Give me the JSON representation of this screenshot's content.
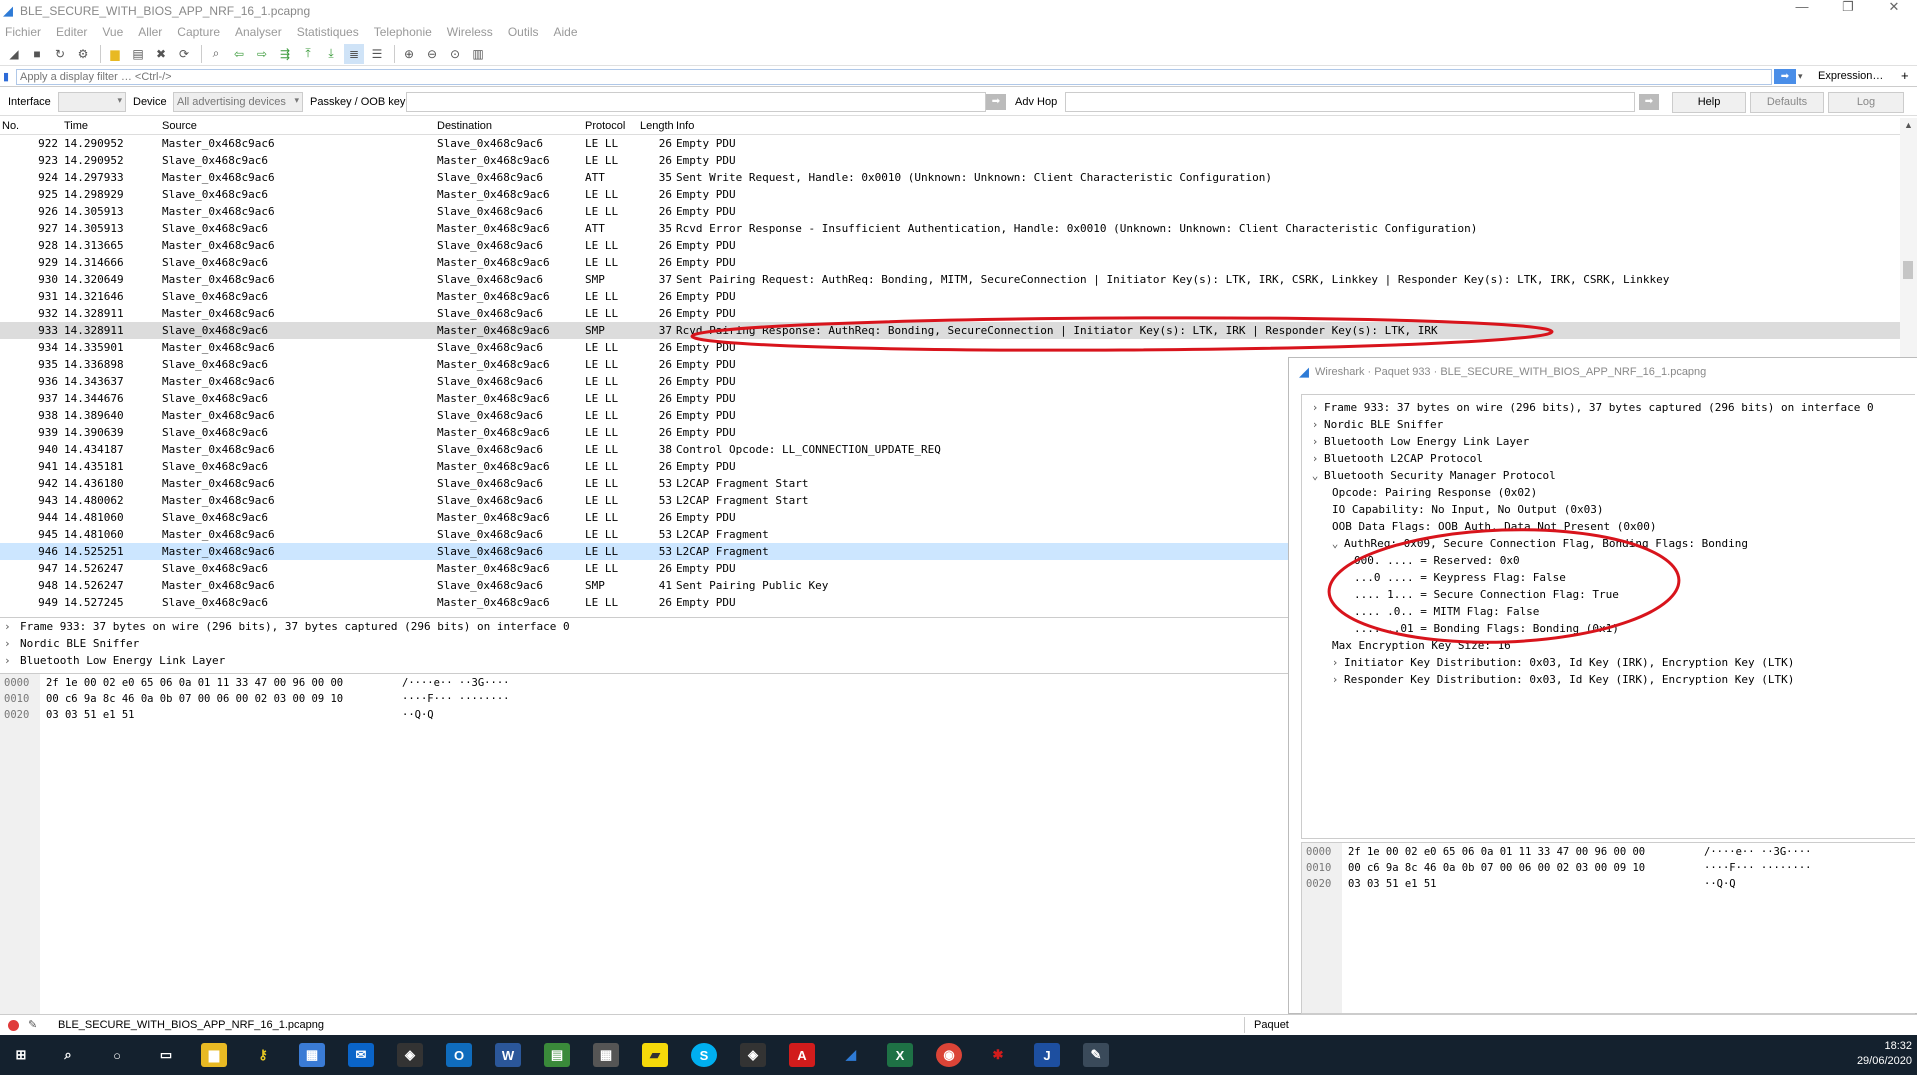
{
  "window": {
    "title": "BLE_SECURE_WITH_BIOS_APP_NRF_16_1.pcapng",
    "minimize": "—",
    "restore": "❐",
    "close": "✕"
  },
  "menu": [
    "Fichier",
    "Editer",
    "Vue",
    "Aller",
    "Capture",
    "Analyser",
    "Statistiques",
    "Telephonie",
    "Wireless",
    "Outils",
    "Aide"
  ],
  "filter": {
    "placeholder": "Apply a display filter … <Ctrl-/>",
    "expression": "Expression…",
    "plus": "+"
  },
  "ifbar": {
    "interface_label": "Interface",
    "device_label": "Device",
    "device_value": "All advertising devices",
    "passkey_label": "Passkey / OOB key",
    "advhop_label": "Adv Hop",
    "help": "Help",
    "defaults": "Defaults",
    "log": "Log"
  },
  "columns": {
    "no": "No.",
    "time": "Time",
    "source": "Source",
    "destination": "Destination",
    "protocol": "Protocol",
    "length": "Length",
    "info": "Info"
  },
  "packets": [
    {
      "no": "922",
      "time": "14.290952",
      "src": "Master_0x468c9ac6",
      "dst": "Slave_0x468c9ac6",
      "proto": "LE LL",
      "len": "26",
      "info": "Empty PDU"
    },
    {
      "no": "923",
      "time": "14.290952",
      "src": "Slave_0x468c9ac6",
      "dst": "Master_0x468c9ac6",
      "proto": "LE LL",
      "len": "26",
      "info": "Empty PDU"
    },
    {
      "no": "924",
      "time": "14.297933",
      "src": "Master_0x468c9ac6",
      "dst": "Slave_0x468c9ac6",
      "proto": "ATT",
      "len": "35",
      "info": "Sent Write Request, Handle: 0x0010 (Unknown: Unknown: Client Characteristic Configuration)"
    },
    {
      "no": "925",
      "time": "14.298929",
      "src": "Slave_0x468c9ac6",
      "dst": "Master_0x468c9ac6",
      "proto": "LE LL",
      "len": "26",
      "info": "Empty PDU"
    },
    {
      "no": "926",
      "time": "14.305913",
      "src": "Master_0x468c9ac6",
      "dst": "Slave_0x468c9ac6",
      "proto": "LE LL",
      "len": "26",
      "info": "Empty PDU"
    },
    {
      "no": "927",
      "time": "14.305913",
      "src": "Slave_0x468c9ac6",
      "dst": "Master_0x468c9ac6",
      "proto": "ATT",
      "len": "35",
      "info": "Rcvd Error Response - Insufficient Authentication, Handle: 0x0010 (Unknown: Unknown: Client Characteristic Configuration)"
    },
    {
      "no": "928",
      "time": "14.313665",
      "src": "Master_0x468c9ac6",
      "dst": "Slave_0x468c9ac6",
      "proto": "LE LL",
      "len": "26",
      "info": "Empty PDU"
    },
    {
      "no": "929",
      "time": "14.314666",
      "src": "Slave_0x468c9ac6",
      "dst": "Master_0x468c9ac6",
      "proto": "LE LL",
      "len": "26",
      "info": "Empty PDU"
    },
    {
      "no": "930",
      "time": "14.320649",
      "src": "Master_0x468c9ac6",
      "dst": "Slave_0x468c9ac6",
      "proto": "SMP",
      "len": "37",
      "info": "Sent Pairing Request: AuthReq: Bonding, MITM, SecureConnection | Initiator Key(s): LTK, IRK, CSRK, Linkkey | Responder Key(s): LTK, IRK, CSRK, Linkkey"
    },
    {
      "no": "931",
      "time": "14.321646",
      "src": "Slave_0x468c9ac6",
      "dst": "Master_0x468c9ac6",
      "proto": "LE LL",
      "len": "26",
      "info": "Empty PDU"
    },
    {
      "no": "932",
      "time": "14.328911",
      "src": "Master_0x468c9ac6",
      "dst": "Slave_0x468c9ac6",
      "proto": "LE LL",
      "len": "26",
      "info": "Empty PDU"
    },
    {
      "no": "933",
      "time": "14.328911",
      "src": "Slave_0x468c9ac6",
      "dst": "Master_0x468c9ac6",
      "proto": "SMP",
      "len": "37",
      "info": "Rcvd Pairing Response: AuthReq: Bonding, SecureConnection | Initiator Key(s): LTK, IRK | Responder Key(s): LTK, IRK"
    },
    {
      "no": "934",
      "time": "14.335901",
      "src": "Master_0x468c9ac6",
      "dst": "Slave_0x468c9ac6",
      "proto": "LE LL",
      "len": "26",
      "info": "Empty PDU"
    },
    {
      "no": "935",
      "time": "14.336898",
      "src": "Slave_0x468c9ac6",
      "dst": "Master_0x468c9ac6",
      "proto": "LE LL",
      "len": "26",
      "info": "Empty PDU"
    },
    {
      "no": "936",
      "time": "14.343637",
      "src": "Master_0x468c9ac6",
      "dst": "Slave_0x468c9ac6",
      "proto": "LE LL",
      "len": "26",
      "info": "Empty PDU"
    },
    {
      "no": "937",
      "time": "14.344676",
      "src": "Slave_0x468c9ac6",
      "dst": "Master_0x468c9ac6",
      "proto": "LE LL",
      "len": "26",
      "info": "Empty PDU"
    },
    {
      "no": "938",
      "time": "14.389640",
      "src": "Master_0x468c9ac6",
      "dst": "Slave_0x468c9ac6",
      "proto": "LE LL",
      "len": "26",
      "info": "Empty PDU"
    },
    {
      "no": "939",
      "time": "14.390639",
      "src": "Slave_0x468c9ac6",
      "dst": "Master_0x468c9ac6",
      "proto": "LE LL",
      "len": "26",
      "info": "Empty PDU"
    },
    {
      "no": "940",
      "time": "14.434187",
      "src": "Master_0x468c9ac6",
      "dst": "Slave_0x468c9ac6",
      "proto": "LE LL",
      "len": "38",
      "info": "Control Opcode: LL_CONNECTION_UPDATE_REQ"
    },
    {
      "no": "941",
      "time": "14.435181",
      "src": "Slave_0x468c9ac6",
      "dst": "Master_0x468c9ac6",
      "proto": "LE LL",
      "len": "26",
      "info": "Empty PDU"
    },
    {
      "no": "942",
      "time": "14.436180",
      "src": "Master_0x468c9ac6",
      "dst": "Slave_0x468c9ac6",
      "proto": "LE LL",
      "len": "53",
      "info": "L2CAP Fragment Start"
    },
    {
      "no": "943",
      "time": "14.480062",
      "src": "Master_0x468c9ac6",
      "dst": "Slave_0x468c9ac6",
      "proto": "LE LL",
      "len": "53",
      "info": "L2CAP Fragment Start"
    },
    {
      "no": "944",
      "time": "14.481060",
      "src": "Slave_0x468c9ac6",
      "dst": "Master_0x468c9ac6",
      "proto": "LE LL",
      "len": "26",
      "info": "Empty PDU"
    },
    {
      "no": "945",
      "time": "14.481060",
      "src": "Master_0x468c9ac6",
      "dst": "Slave_0x468c9ac6",
      "proto": "LE LL",
      "len": "53",
      "info": "L2CAP Fragment"
    },
    {
      "no": "946",
      "time": "14.525251",
      "src": "Master_0x468c9ac6",
      "dst": "Slave_0x468c9ac6",
      "proto": "LE LL",
      "len": "53",
      "info": "L2CAP Fragment"
    },
    {
      "no": "947",
      "time": "14.526247",
      "src": "Slave_0x468c9ac6",
      "dst": "Master_0x468c9ac6",
      "proto": "LE LL",
      "len": "26",
      "info": "Empty PDU"
    },
    {
      "no": "948",
      "time": "14.526247",
      "src": "Master_0x468c9ac6",
      "dst": "Slave_0x468c9ac6",
      "proto": "SMP",
      "len": "41",
      "info": "Sent Pairing Public Key"
    },
    {
      "no": "949",
      "time": "14.527245",
      "src": "Slave_0x468c9ac6",
      "dst": "Master_0x468c9ac6",
      "proto": "LE LL",
      "len": "26",
      "info": "Empty PDU"
    }
  ],
  "detail": [
    "Frame 933: 37 bytes on wire (296 bits), 37 bytes captured (296 bits) on interface 0",
    "Nordic BLE Sniffer",
    "Bluetooth Low Energy Link Layer"
  ],
  "hex": [
    {
      "off": "0000",
      "hex": "2f 1e 00 02 e0 65 06 0a  01 11 33 47 00 96 00 00",
      "ascii": "/····e·· ··3G····"
    },
    {
      "off": "0010",
      "hex": "00 c6 9a 8c 46 0a 0b 07  00 06 00 02 03 00 09 10",
      "ascii": "····F··· ········"
    },
    {
      "off": "0020",
      "hex": "03 03 51 e1 51",
      "ascii": "··Q·Q"
    }
  ],
  "popup": {
    "title": "Wireshark · Paquet 933 · BLE_SECURE_WITH_BIOS_APP_NRF_16_1.pcapng",
    "tree": [
      {
        "text": "Frame 933: 37 bytes on wire (296 bits), 37 bytes captured (296 bits) on interface 0",
        "chev": "›"
      },
      {
        "text": "Nordic BLE Sniffer",
        "chev": "›"
      },
      {
        "text": "Bluetooth Low Energy Link Layer",
        "chev": "›"
      },
      {
        "text": "Bluetooth L2CAP Protocol",
        "chev": "›"
      },
      {
        "text": "Bluetooth Security Manager Protocol",
        "chev": "⌄"
      },
      {
        "text": "Opcode: Pairing Response (0x02)",
        "chev": ""
      },
      {
        "text": "IO Capability: No Input, No Output (0x03)",
        "chev": ""
      },
      {
        "text": "OOB Data Flags: OOB Auth. Data Not Present (0x00)",
        "chev": ""
      },
      {
        "text": "AuthReq: 0x09, Secure Connection Flag, Bonding Flags: Bonding",
        "chev": "⌄"
      },
      {
        "text": "000. .... = Reserved: 0x0",
        "chev": ""
      },
      {
        "text": "...0 .... = Keypress Flag: False",
        "chev": ""
      },
      {
        "text": ".... 1... = Secure Connection Flag: True",
        "chev": ""
      },
      {
        "text": ".... .0.. = MITM Flag: False",
        "chev": ""
      },
      {
        "text": ".... ..01 = Bonding Flags: Bonding (0x1)",
        "chev": ""
      },
      {
        "text": "Max Encryption Key Size: 16",
        "chev": ""
      },
      {
        "text": "Initiator Key Distribution: 0x03, Id Key (IRK), Encryption Key (LTK)",
        "chev": "›"
      },
      {
        "text": "Responder Key Distribution: 0x03, Id Key (IRK), Encryption Key (LTK)",
        "chev": "›"
      }
    ]
  },
  "status": {
    "file": "BLE_SECURE_WITH_BIOS_APP_NRF_16_1.pcapng",
    "paquet": "Paquet"
  },
  "taskbar": {
    "time": "18:32",
    "date": "29/06/2020"
  },
  "colors": {
    "annotation": "#d8141c",
    "selection": "#dcdcdc",
    "highlight": "#cce6ff"
  }
}
